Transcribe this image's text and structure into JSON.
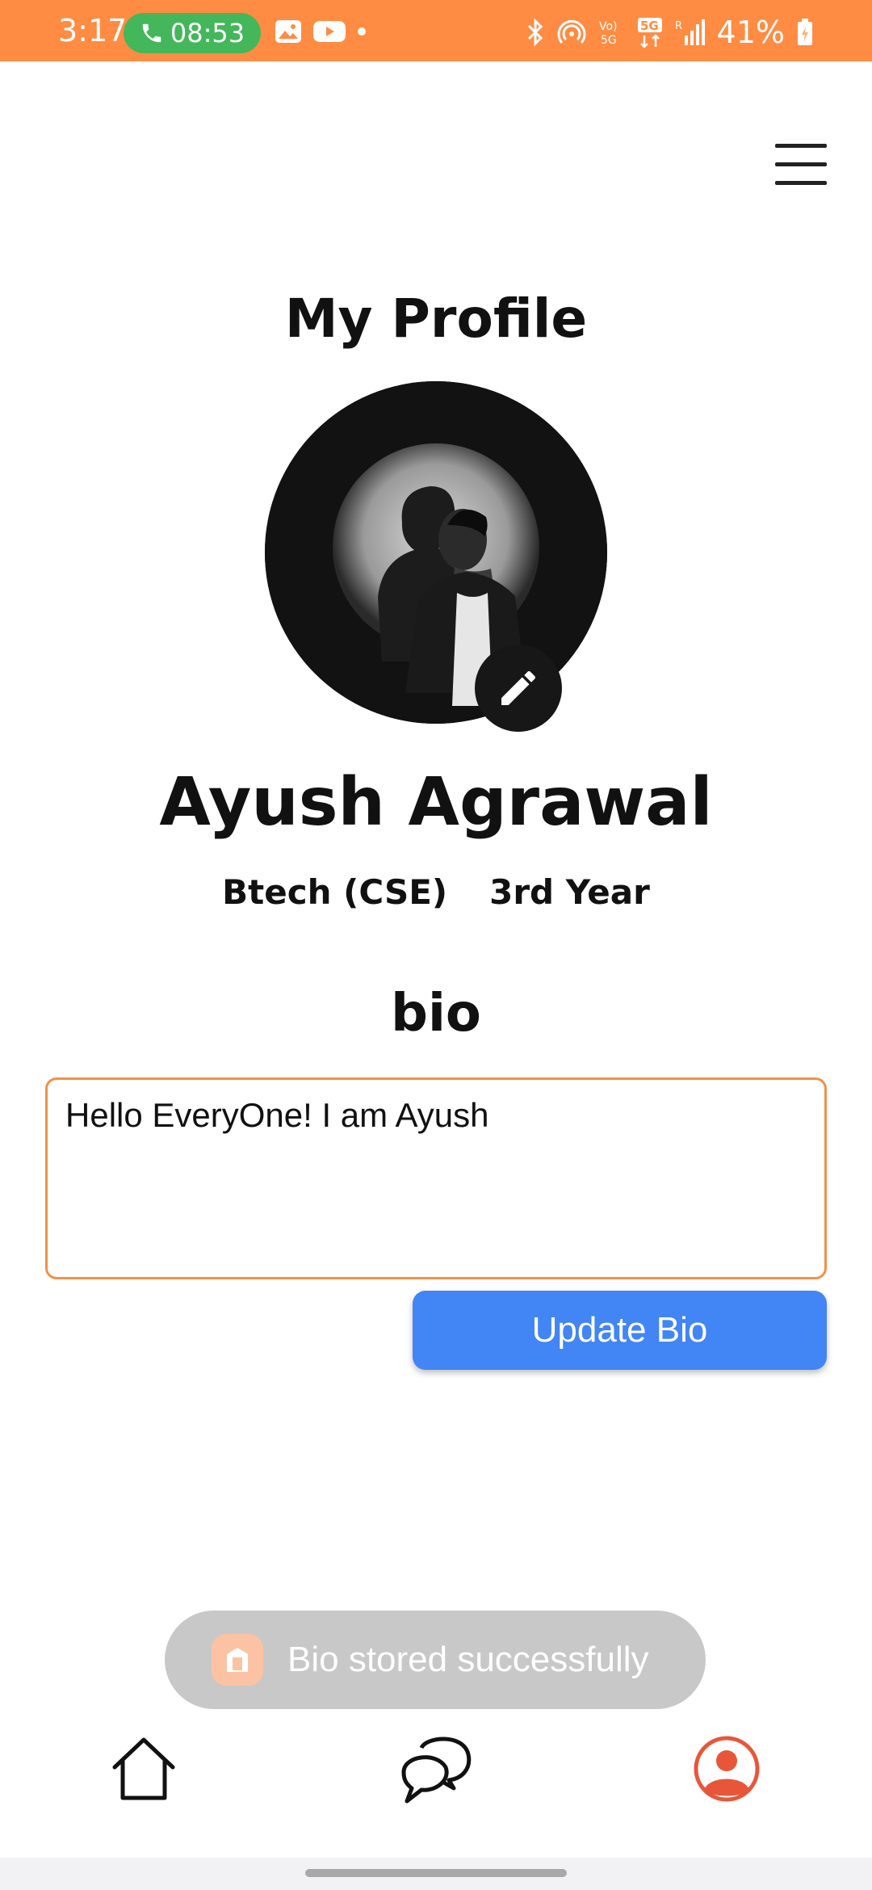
{
  "status_bar": {
    "time": "3:17",
    "call_timer": "08:53",
    "battery": "41%",
    "icons_left": [
      "gallery-icon",
      "youtube-icon",
      "dot-icon"
    ],
    "icons_right": [
      "bluetooth-icon",
      "hotspot-icon",
      "volte-icon",
      "5g-icon",
      "signal-icon",
      "battery-icon"
    ],
    "volte_label": "Vo) 5G",
    "network_label": "5G",
    "signal_label": "R",
    "color": "#FF8C42"
  },
  "header": {
    "title": "My Profile",
    "menu_icon": "hamburger-menu-icon"
  },
  "profile": {
    "name": "Ayush Agrawal",
    "course": "Btech (CSE)",
    "year": "3rd Year",
    "edit_icon": "pencil-icon"
  },
  "bio": {
    "heading": "bio",
    "value": "Hello EveryOne! I am Ayush",
    "button_label": "Update Bio",
    "border_color": "#F0914A",
    "button_color": "#4285F4"
  },
  "toast": {
    "message": "Bio stored successfully"
  },
  "bottom_nav": {
    "items": [
      {
        "icon": "home-icon"
      },
      {
        "icon": "chat-icon"
      },
      {
        "icon": "profile-icon",
        "active": true
      }
    ],
    "active_color": "#E8563A"
  }
}
